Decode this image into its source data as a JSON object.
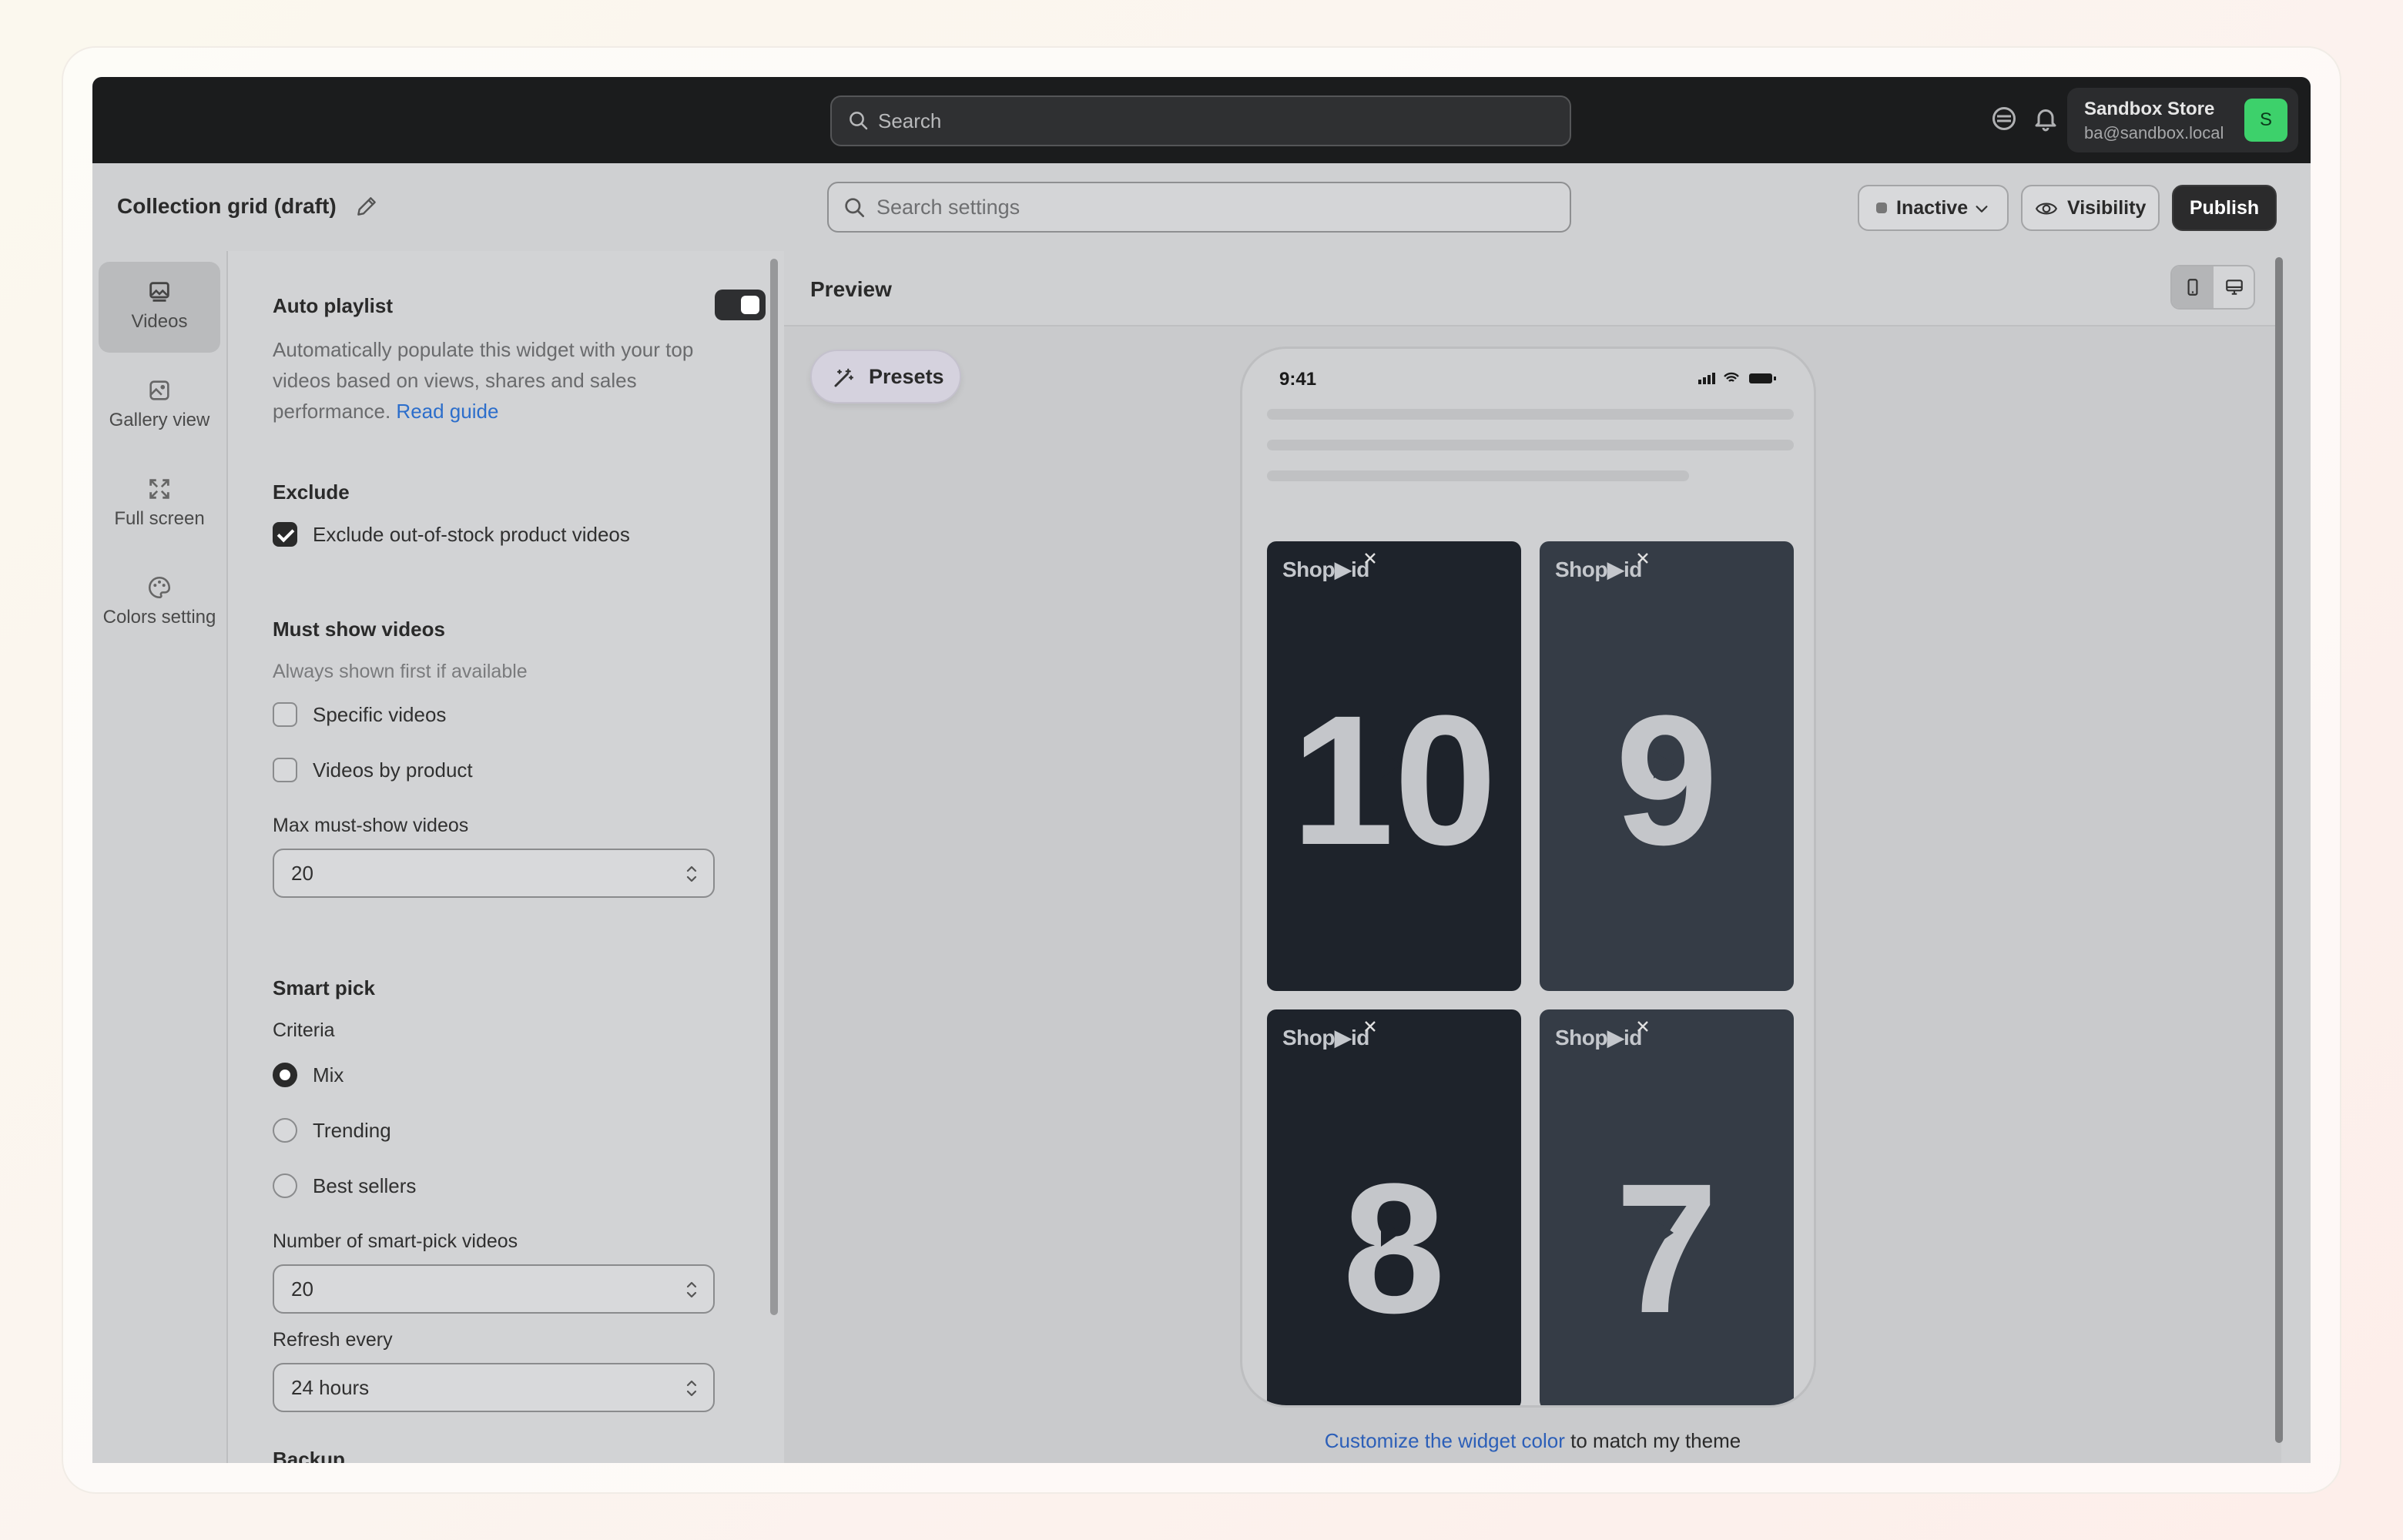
{
  "topbar": {
    "search_placeholder": "Search",
    "store_name": "Sandbox Store",
    "store_email": "ba@sandbox.local",
    "avatar_letter": "S"
  },
  "header": {
    "title": "Collection grid (draft)",
    "settings_search_placeholder": "Search settings",
    "status_label": "Inactive",
    "visibility_label": "Visibility",
    "publish_label": "Publish"
  },
  "rail": {
    "items": [
      {
        "label": "Videos",
        "icon": "image-icon",
        "active": true
      },
      {
        "label": "Gallery view",
        "icon": "gallery-icon",
        "active": false
      },
      {
        "label": "Full screen",
        "icon": "expand-icon",
        "active": false
      },
      {
        "label": "Colors setting",
        "icon": "palette-icon",
        "active": false
      }
    ]
  },
  "panel": {
    "auto_playlist": {
      "title": "Auto playlist",
      "enabled": true,
      "description": "Automatically populate this widget with your top videos based on views, shares and sales performance.",
      "link": "Read guide"
    },
    "exclude": {
      "title": "Exclude",
      "option_label": "Exclude out-of-stock product videos",
      "checked": true
    },
    "must_show": {
      "title": "Must show videos",
      "subtitle": "Always shown first if available",
      "options": [
        {
          "label": "Specific videos",
          "checked": false
        },
        {
          "label": "Videos by product",
          "checked": false
        }
      ],
      "max_label": "Max must-show videos",
      "max_value": "20"
    },
    "smart_pick": {
      "title": "Smart pick",
      "criteria_label": "Criteria",
      "criteria": [
        {
          "label": "Mix",
          "selected": true
        },
        {
          "label": "Trending",
          "selected": false
        },
        {
          "label": "Best sellers",
          "selected": false
        }
      ],
      "count_label": "Number of smart-pick videos",
      "count_value": "20",
      "refresh_label": "Refresh every",
      "refresh_value": "24 hours"
    },
    "backup": {
      "title": "Backup"
    }
  },
  "preview": {
    "title": "Preview",
    "presets_label": "Presets",
    "phone_time": "9:41",
    "tiles": [
      {
        "brand": "Shop▶id",
        "number": "10"
      },
      {
        "brand": "Shop▶id",
        "number": "9"
      },
      {
        "brand": "Shop▶id",
        "number": "8"
      },
      {
        "brand": "Shop▶id",
        "number": "7"
      }
    ],
    "customize_link": "Customize the widget color",
    "customize_rest": " to match my theme"
  },
  "colors": {
    "accent_link": "#2c6ecb",
    "avatar_green": "#3dd16b",
    "publish_bg": "#2b2b2c"
  }
}
